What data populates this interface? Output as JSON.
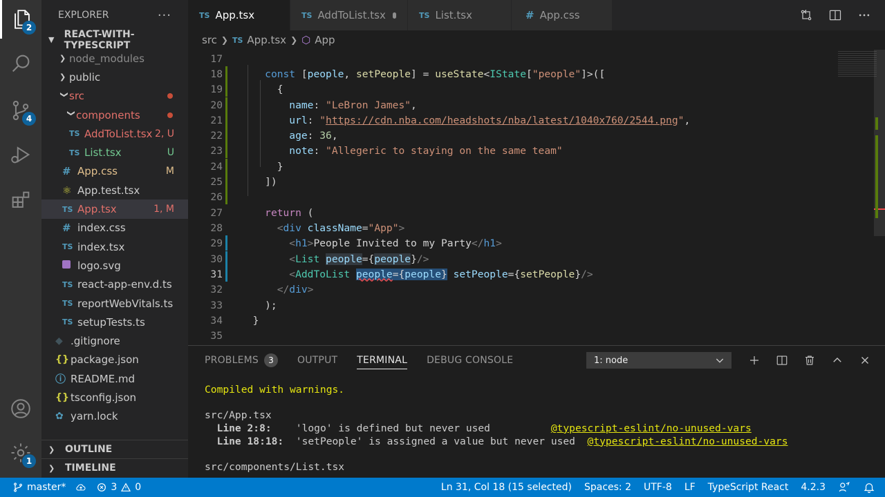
{
  "activity_bar": {
    "explorer_badge": "2",
    "scm_badge": "4",
    "settings_badge": "1"
  },
  "sidebar": {
    "title": "EXPLORER",
    "more": "···",
    "project": "REACT-WITH-TYPESCRIPT",
    "items": [
      {
        "label": "node_modules",
        "status": ""
      },
      {
        "label": "public",
        "status": ""
      },
      {
        "label": "src",
        "status": ""
      },
      {
        "label": "components",
        "status": ""
      },
      {
        "label": "AddToList.tsx",
        "status": "2, U"
      },
      {
        "label": "List.tsx",
        "status": "U"
      },
      {
        "label": "App.css",
        "status": "M"
      },
      {
        "label": "App.test.tsx",
        "status": ""
      },
      {
        "label": "App.tsx",
        "status": "1, M"
      },
      {
        "label": "index.css",
        "status": ""
      },
      {
        "label": "index.tsx",
        "status": ""
      },
      {
        "label": "logo.svg",
        "status": ""
      },
      {
        "label": "react-app-env.d.ts",
        "status": ""
      },
      {
        "label": "reportWebVitals.ts",
        "status": ""
      },
      {
        "label": "setupTests.ts",
        "status": ""
      },
      {
        "label": ".gitignore",
        "status": ""
      },
      {
        "label": "package.json",
        "status": ""
      },
      {
        "label": "README.md",
        "status": ""
      },
      {
        "label": "tsconfig.json",
        "status": ""
      },
      {
        "label": "yarn.lock",
        "status": ""
      }
    ],
    "outline": "OUTLINE",
    "timeline": "TIMELINE"
  },
  "tabs": [
    {
      "label": "App.tsx",
      "icon": "TS"
    },
    {
      "label": "AddToList.tsx",
      "icon": "TS"
    },
    {
      "label": "List.tsx",
      "icon": "TS"
    },
    {
      "label": "App.css",
      "icon": "#"
    }
  ],
  "breadcrumb": {
    "folder": "src",
    "file": "App.tsx",
    "symbol": "App"
  },
  "editor": {
    "line_numbers": [
      "17",
      "18",
      "19",
      "20",
      "21",
      "22",
      "23",
      "24",
      "25",
      "26",
      "27",
      "28",
      "29",
      "30",
      "31",
      "32",
      "33",
      "34",
      "35"
    ],
    "url": "https://cdn.nba.com/headshots/nba/latest/1040x760/2544.png",
    "name_value": "\"LeBron James\"",
    "age_value": "36",
    "note_value": "\"Allegeric to staying on the same team\"",
    "h1_text": "People Invited to my Party",
    "istate_key": "\"people\""
  },
  "panel": {
    "tabs": [
      "PROBLEMS",
      "OUTPUT",
      "TERMINAL",
      "DEBUG CONSOLE"
    ],
    "problems_count": "3",
    "terminal_select": "1: node",
    "terminal_lines": {
      "compiled": "Compiled with warnings.",
      "file1": "src/App.tsx",
      "w1_loc": "  Line 2:8:",
      "w1_msg": "    'logo' is defined but never used          ",
      "w1_rule": "@typescript-eslint/no-unused-vars",
      "w2_loc": "  Line 18:18:",
      "w2_msg": "  'setPeople' is assigned a value but never used  ",
      "w2_rule": "@typescript-eslint/no-unused-vars",
      "file2": "src/components/List.tsx"
    }
  },
  "statusbar": {
    "branch": "master*",
    "errors": "3",
    "warnings": "0",
    "cursor": "Ln 31, Col 18 (15 selected)",
    "spaces": "Spaces: 2",
    "encoding": "UTF-8",
    "eol": "LF",
    "language": "TypeScript React",
    "version": "4.2.3"
  },
  "colors": {
    "accent": "#007acc",
    "editor_bg": "#1e1e1e",
    "sidebar_bg": "#252526",
    "activity_bg": "#333333"
  }
}
